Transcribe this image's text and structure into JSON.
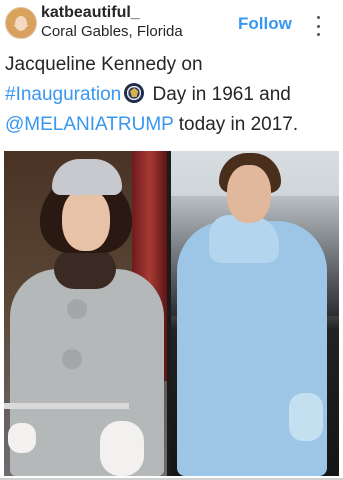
{
  "post": {
    "username": "katbeautiful_",
    "location": "Coral Gables, Florida",
    "follow_label": "Follow",
    "caption": {
      "part1": "Jacqueline Kennedy on",
      "hashtag": "#Inauguration",
      "part2": " Day in 1961 and",
      "mention": "@MELANIATRUMP",
      "part3": " today in 2017."
    }
  },
  "colors": {
    "link": "#3897f0",
    "text": "#262626"
  },
  "icons": {
    "more": "more-vertical-icon",
    "seal": "presidential-seal-icon"
  }
}
